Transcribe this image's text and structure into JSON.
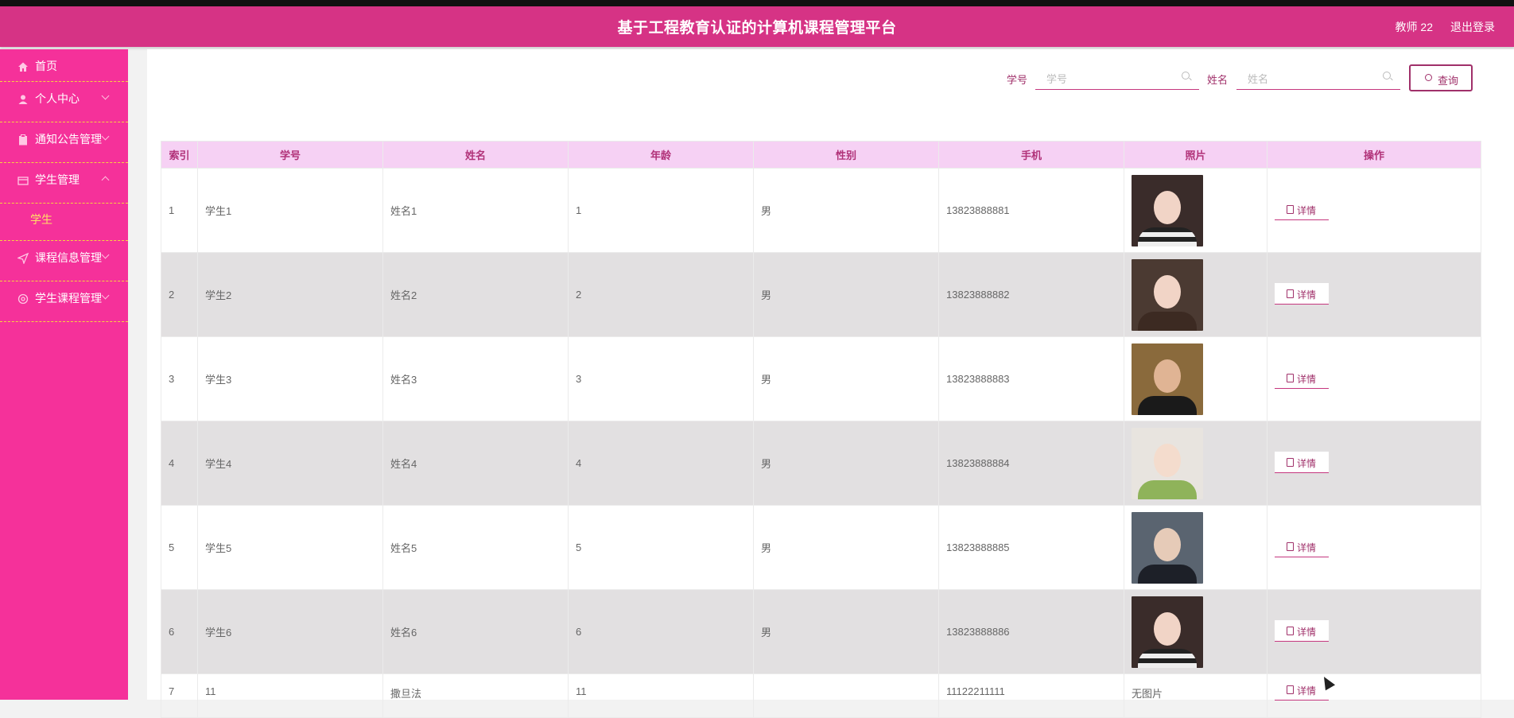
{
  "header": {
    "title": "基于工程教育认证的计算机课程管理平台",
    "user": "教师 22",
    "logout": "退出登录"
  },
  "sidebar": {
    "items": [
      {
        "label": "首页",
        "icon": "home-icon"
      },
      {
        "label": "个人中心",
        "icon": "user-icon"
      },
      {
        "label": "通知公告管理",
        "icon": "clipboard-icon"
      },
      {
        "label": "学生管理",
        "icon": "folder-icon"
      },
      {
        "label": "课程信息管理",
        "icon": "send-icon"
      },
      {
        "label": "学生课程管理",
        "icon": "gear-icon"
      }
    ],
    "sub_item": "学生"
  },
  "search": {
    "xuehao_label": "学号",
    "xuehao_placeholder": "学号",
    "xingming_label": "姓名",
    "xingming_placeholder": "姓名",
    "query_button": "查询"
  },
  "table": {
    "headers": [
      "索引",
      "学号",
      "姓名",
      "年龄",
      "性别",
      "手机",
      "照片",
      "操作"
    ],
    "detail_label": "详情",
    "no_photo": "无图片",
    "rows": [
      {
        "index": "1",
        "xuehao": "学生1",
        "name": "姓名1",
        "age": "1",
        "gender": "男",
        "phone": "13823888881"
      },
      {
        "index": "2",
        "xuehao": "学生2",
        "name": "姓名2",
        "age": "2",
        "gender": "男",
        "phone": "13823888882"
      },
      {
        "index": "3",
        "xuehao": "学生3",
        "name": "姓名3",
        "age": "3",
        "gender": "男",
        "phone": "13823888883"
      },
      {
        "index": "4",
        "xuehao": "学生4",
        "name": "姓名4",
        "age": "4",
        "gender": "男",
        "phone": "13823888884"
      },
      {
        "index": "5",
        "xuehao": "学生5",
        "name": "姓名5",
        "age": "5",
        "gender": "男",
        "phone": "13823888885"
      },
      {
        "index": "6",
        "xuehao": "学生6",
        "name": "姓名6",
        "age": "6",
        "gender": "男",
        "phone": "13823888886"
      },
      {
        "index": "7",
        "xuehao": "11",
        "name": "撒旦法",
        "age": "11",
        "gender": "",
        "phone": "11122211111"
      }
    ]
  },
  "colors": {
    "header_bg": "#d63385",
    "sidebar_bg": "#f5319a",
    "accent": "#a0306a",
    "table_header_bg": "#f6d1f4",
    "menu_divider": "#f7d33f",
    "active_sub": "#ffe066"
  }
}
